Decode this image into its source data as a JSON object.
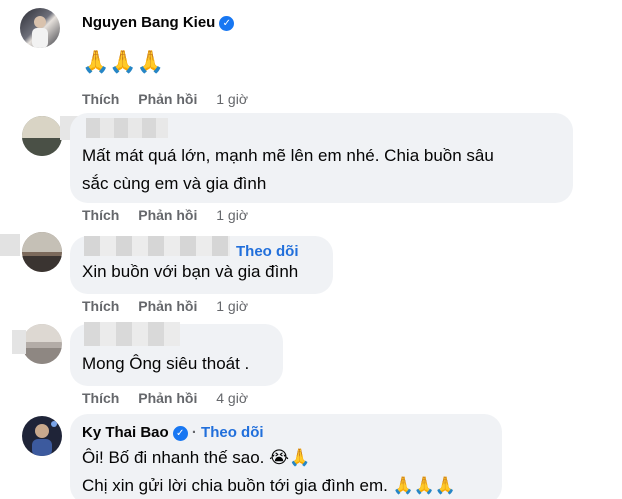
{
  "comments": [
    {
      "author": "Nguyen Bang Kieu",
      "verified": true,
      "text_lines": [],
      "emoji_line": "🙏🙏🙏",
      "actions": {
        "like": "Thích",
        "reply": "Phản hồi",
        "time": "1 giờ"
      }
    },
    {
      "author": "",
      "text_lines": [
        "Mất mát quá lớn, mạnh mẽ lên em nhé. Chia buồn sâu",
        "sắc cùng em và gia đình"
      ],
      "actions": {
        "like": "Thích",
        "reply": "Phản hồi",
        "time": "1 giờ"
      }
    },
    {
      "author": "",
      "follow": "Theo dõi",
      "text_lines": [
        "Xin buồn với bạn và gia đình"
      ],
      "actions": {
        "like": "Thích",
        "reply": "Phản hồi",
        "time": "1 giờ"
      }
    },
    {
      "author": "",
      "text_lines": [
        "Mong Ông siêu thoát ."
      ],
      "actions": {
        "like": "Thích",
        "reply": "Phản hồi",
        "time": "4 giờ"
      }
    },
    {
      "author": "Ky Thai Bao",
      "verified": true,
      "follow": "Theo dõi",
      "separator": "·",
      "text_lines": [
        "Ôi! Bố đi nhanh thế sao. 😭🙏",
        "Chị xin gửi lời chia buồn tới gia đình em. 🙏🙏🙏"
      ]
    }
  ],
  "icons": {
    "verified": "verified-check-icon",
    "pray": "folded-hands-emoji"
  },
  "colors": {
    "bubble": "#f0f2f5",
    "link": "#216fdb",
    "meta": "#65676b",
    "verified": "#1877f2"
  }
}
